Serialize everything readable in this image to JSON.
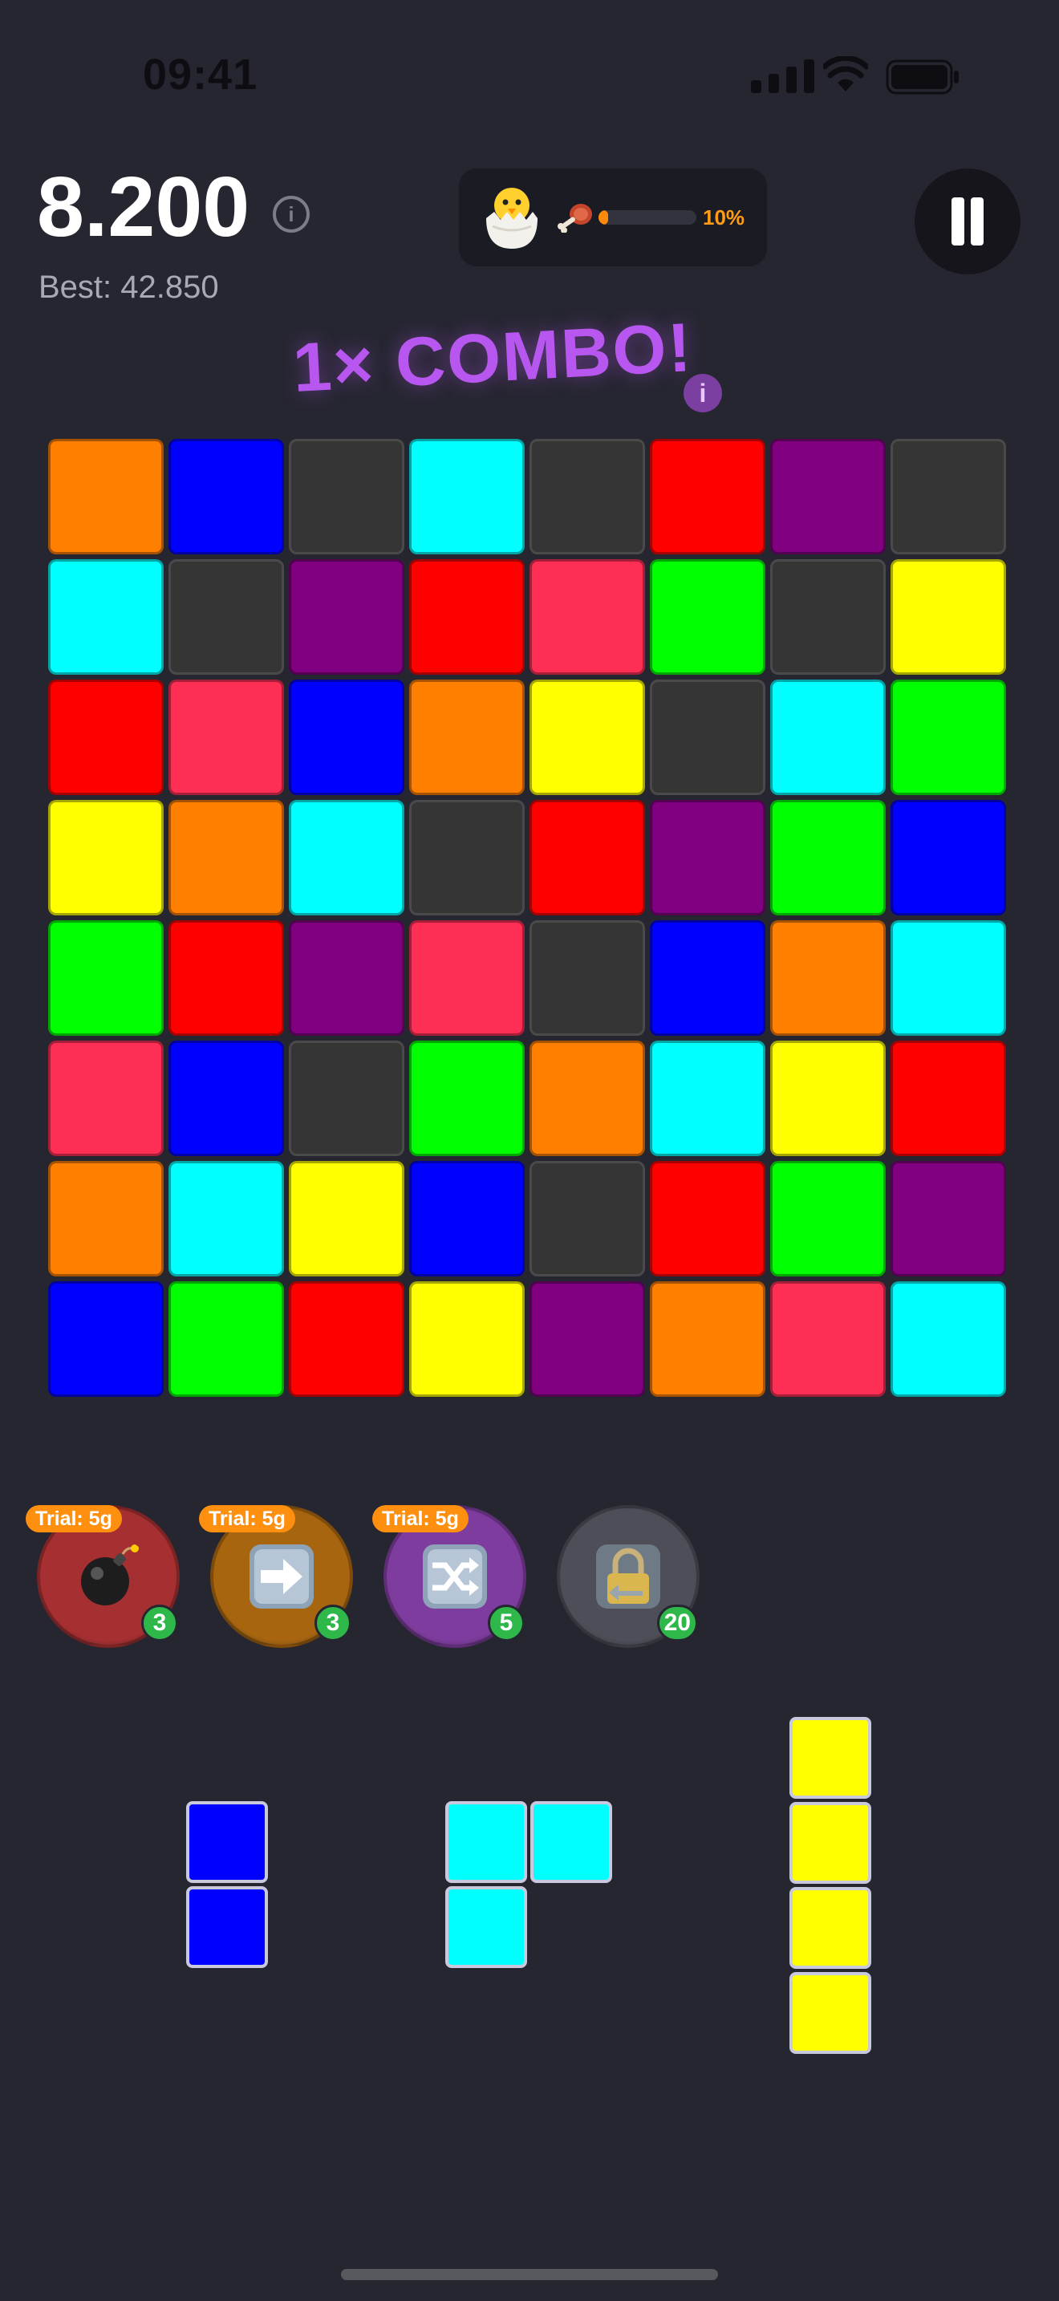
{
  "status_bar": {
    "time": "09:41"
  },
  "header": {
    "score": "8.200",
    "best_label": "Best: 42.850",
    "info_glyph": "i",
    "pet": {
      "icon": "hatching-chick-icon",
      "food_icon": "meat-icon",
      "progress": 0.1,
      "progress_label": "10%"
    },
    "pause_icon": "pause-icon"
  },
  "combo": {
    "label": "1× COMBO!",
    "info_glyph": "i"
  },
  "colors": {
    "O": "#ff7f00",
    "B": "#0000ff",
    "E": "#353535",
    "C": "#00ffff",
    "R": "#ff0000",
    "P": "#800080",
    "K": "#ff2e55",
    "G": "#00ff00",
    "Y": "#ffff00"
  },
  "board": {
    "rows": [
      [
        "O",
        "B",
        "E",
        "C",
        "E",
        "R",
        "P",
        "E"
      ],
      [
        "C",
        "E",
        "P",
        "R",
        "K",
        "G",
        "E",
        "Y"
      ],
      [
        "R",
        "K",
        "B",
        "O",
        "Y",
        "E",
        "C",
        "G"
      ],
      [
        "Y",
        "O",
        "C",
        "E",
        "R",
        "P",
        "G",
        "B"
      ],
      [
        "G",
        "R",
        "P",
        "K",
        "E",
        "B",
        "O",
        "C"
      ],
      [
        "K",
        "B",
        "E",
        "G",
        "O",
        "C",
        "Y",
        "R"
      ],
      [
        "O",
        "C",
        "Y",
        "B",
        "E",
        "R",
        "G",
        "P"
      ],
      [
        "B",
        "G",
        "R",
        "Y",
        "P",
        "O",
        "K",
        "C"
      ]
    ]
  },
  "powerups": [
    {
      "icon": "bomb-icon",
      "trial": "Trial: 5g",
      "count": "3",
      "bg": "#a62f31"
    },
    {
      "icon": "arrow-right-icon",
      "trial": "Trial: 5g",
      "count": "3",
      "bg": "#a8650f"
    },
    {
      "icon": "shuffle-icon",
      "trial": "Trial: 5g",
      "count": "5",
      "bg": "#7e3c9e"
    },
    {
      "icon": "locked-undo-icon",
      "trial": "",
      "count": "20",
      "bg": "#4e4e58"
    }
  ],
  "tray": [
    {
      "color": "B",
      "cells": [
        [
          0,
          0
        ],
        [
          0,
          1
        ]
      ]
    },
    {
      "color": "C",
      "cells": [
        [
          0,
          0
        ],
        [
          1,
          0
        ],
        [
          0,
          1
        ]
      ]
    },
    {
      "color": "Y",
      "cells": [
        [
          0,
          0
        ],
        [
          0,
          1
        ],
        [
          0,
          2
        ],
        [
          0,
          3
        ]
      ]
    }
  ]
}
